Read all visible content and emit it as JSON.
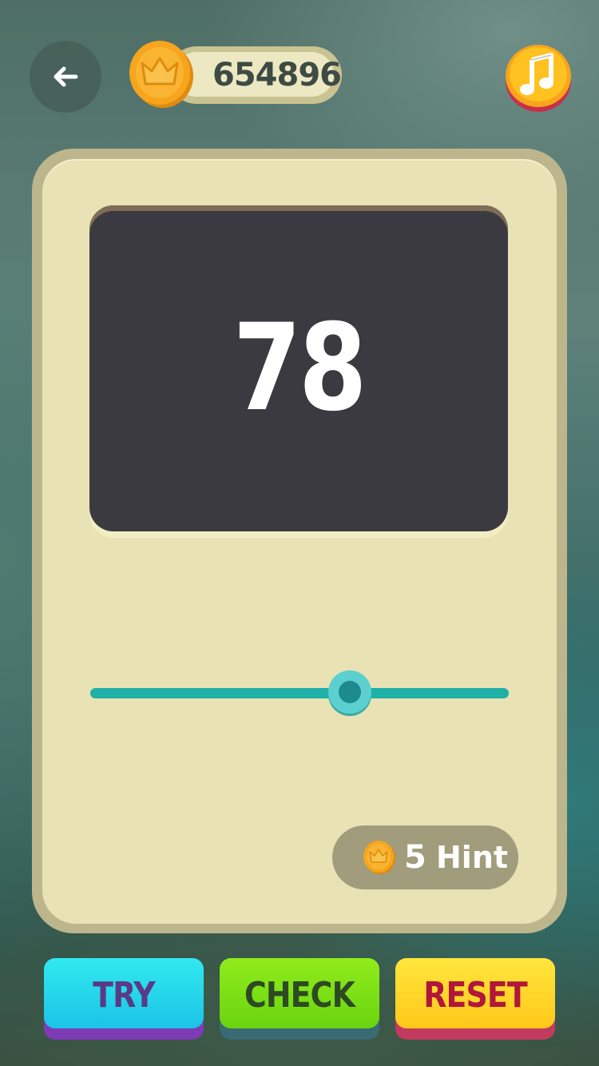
{
  "header": {
    "back_icon": "arrow-left-icon",
    "coin_icon": "crown-coin-icon",
    "coins": "654896",
    "music_icon": "music-note-icon"
  },
  "puzzle": {
    "display_number": "78",
    "slider_value": 0.62
  },
  "hint": {
    "coin_icon": "crown-coin-icon",
    "cost": "5",
    "label": "Hint"
  },
  "buttons": {
    "try_label": "TRY",
    "check_label": "CHECK",
    "reset_label": "RESET"
  },
  "colors": {
    "card": "#e8e2b4",
    "screen": "#3b3a40",
    "slider": "#1fb0a8",
    "try": "#1bc4e6",
    "check": "#6ad40f",
    "reset": "#ffc81a"
  }
}
